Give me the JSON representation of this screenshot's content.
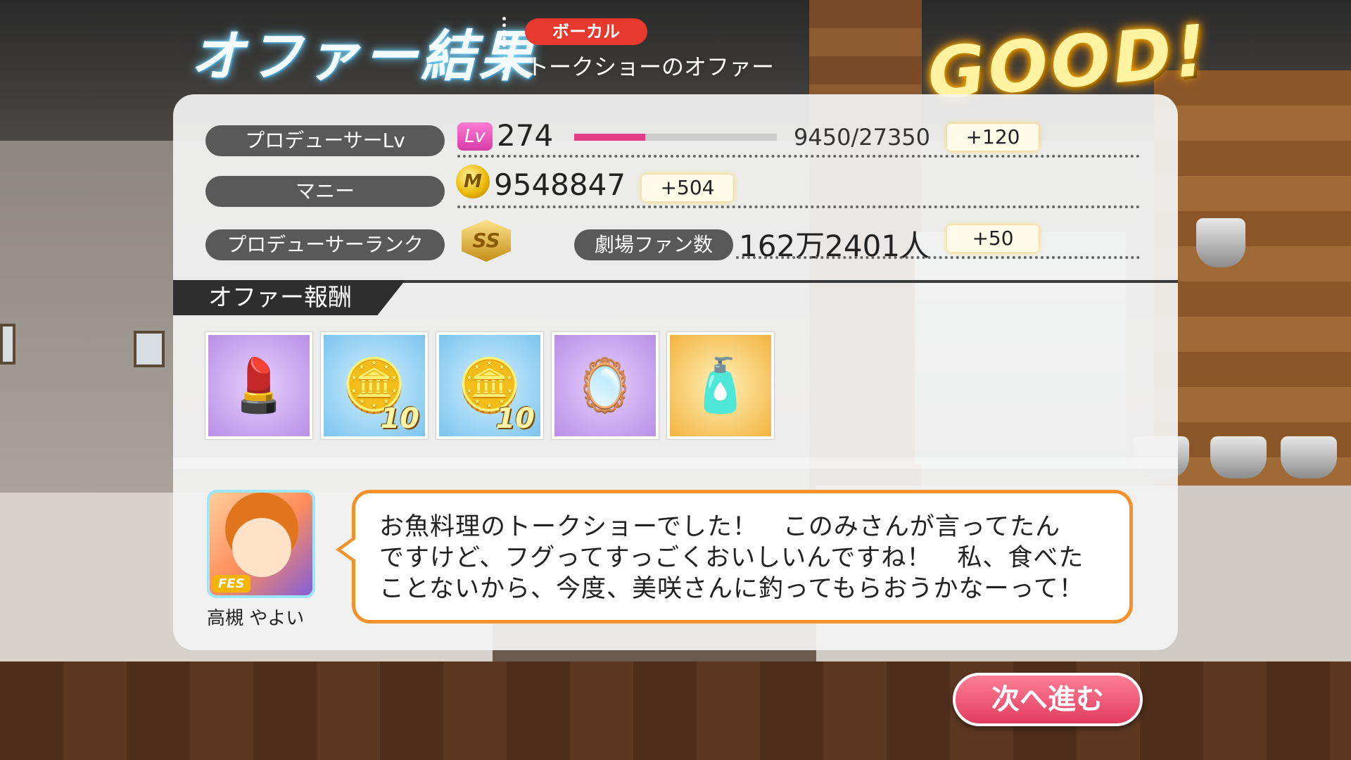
{
  "header": {
    "title": "オファー結果",
    "category_badge": "ボーカル",
    "offer_name": "トークショーのオファー",
    "result": "GOOD!"
  },
  "stats": {
    "producer_lv": {
      "label": "プロデューサーLv",
      "icon_text": "Lv",
      "value": "274",
      "exp_text": "9450/27350",
      "exp_progress": 0.35,
      "gain": "+120"
    },
    "money": {
      "label": "マニー",
      "icon": "coin-icon",
      "icon_text": "M",
      "value": "9548847",
      "gain": "+504"
    },
    "rank": {
      "label": "プロデューサーランク",
      "icon": "rank-ss-icon",
      "rank_text": "SS",
      "fan_label": "劇場ファン数",
      "fans": "162万2401人",
      "gain": "+50"
    }
  },
  "rewards": {
    "heading": "オファー報酬",
    "items": [
      {
        "icon": "lipstick-icon",
        "glyph": "💄",
        "qty": ""
      },
      {
        "icon": "pink-coins-icon",
        "glyph": "🪙",
        "qty": "10"
      },
      {
        "icon": "pink-coins-icon",
        "glyph": "🪙",
        "qty": "10"
      },
      {
        "icon": "hand-mirror-icon",
        "glyph": "🪞",
        "qty": ""
      },
      {
        "icon": "bath-salts-bottle-icon",
        "glyph": "🧴",
        "qty": ""
      }
    ]
  },
  "dialog": {
    "character_name": "高槻 やよい",
    "avatar_badge": "FES",
    "lines": [
      "お魚料理のトークショーでした！　このみさんが言ってたん",
      "ですけど、フグってすっごくおいしいんですね！　私、食べた",
      "ことないから、今度、美咲さんに釣ってもらおうかなーって！"
    ]
  },
  "next_button": "次へ進む",
  "colors": {
    "accent_pink": "#e23e86",
    "badge_red": "#e8392e",
    "bubble_border": "#f3922a",
    "button_pink": "#e13c60",
    "good_gold": "#fff2a0"
  }
}
